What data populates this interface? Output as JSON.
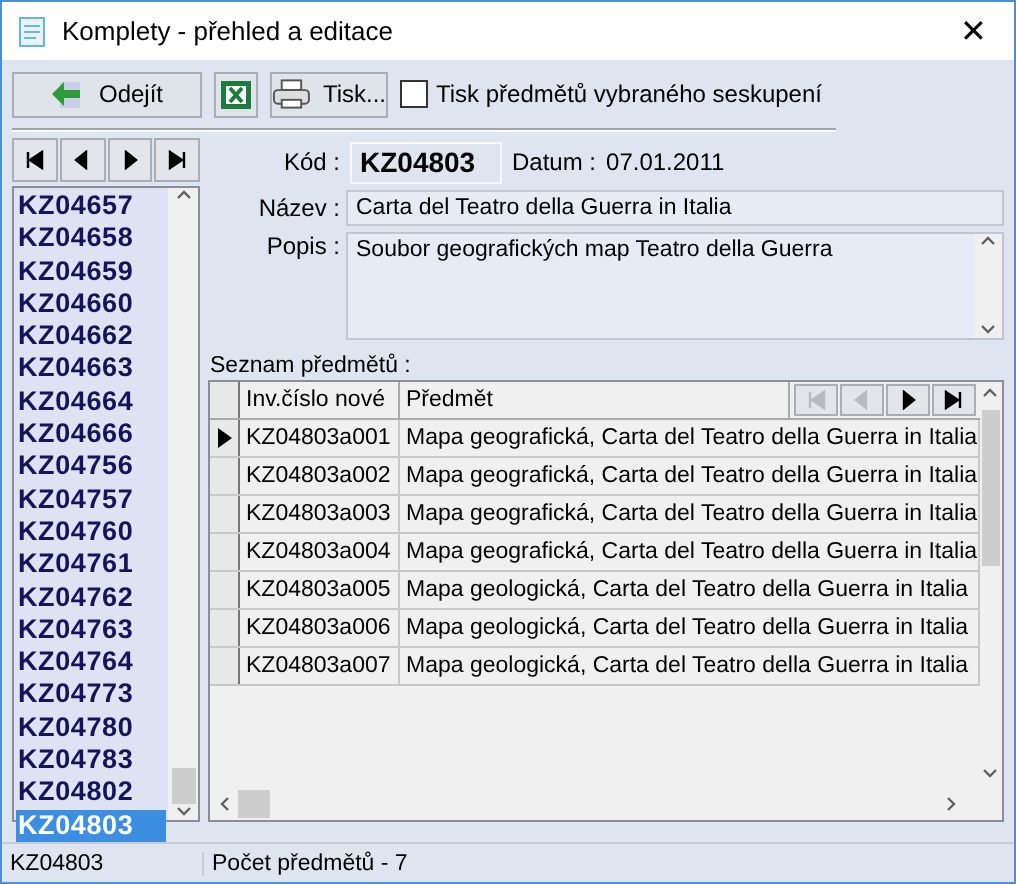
{
  "window": {
    "title": "Komplety - přehled a editace",
    "close": "✕"
  },
  "toolbar": {
    "exit_button": "Odejít",
    "print_button": "Tisk...",
    "print_option": {
      "label": "Tisk předmětů vybraného seskupení",
      "checked": false
    }
  },
  "record_nav": [
    {
      "kind": "first",
      "disabled": false
    },
    {
      "kind": "prev",
      "disabled": false
    },
    {
      "kind": "next",
      "disabled": false
    },
    {
      "kind": "last",
      "disabled": false
    }
  ],
  "list": [
    {
      "label": "KZ04657",
      "selected": false
    },
    {
      "label": "KZ04658",
      "selected": false
    },
    {
      "label": "KZ04659",
      "selected": false
    },
    {
      "label": "KZ04660",
      "selected": false
    },
    {
      "label": "KZ04662",
      "selected": false
    },
    {
      "label": "KZ04663",
      "selected": false
    },
    {
      "label": "KZ04664",
      "selected": false
    },
    {
      "label": "KZ04666",
      "selected": false
    },
    {
      "label": "KZ04756",
      "selected": false
    },
    {
      "label": "KZ04757",
      "selected": false
    },
    {
      "label": "KZ04760",
      "selected": false
    },
    {
      "label": "KZ04761",
      "selected": false
    },
    {
      "label": "KZ04762",
      "selected": false
    },
    {
      "label": "KZ04763",
      "selected": false
    },
    {
      "label": "KZ04764",
      "selected": false
    },
    {
      "label": "KZ04773",
      "selected": false
    },
    {
      "label": "KZ04780",
      "selected": false
    },
    {
      "label": "KZ04783",
      "selected": false
    },
    {
      "label": "KZ04802",
      "selected": false
    },
    {
      "label": "KZ04803",
      "selected": true
    }
  ],
  "detail": {
    "code_label": "Kód :",
    "code": "KZ04803",
    "date_label": "Datum :",
    "date": "07.01.2011",
    "name_label": "Název :",
    "name": "Carta del Teatro della Guerra in Italia",
    "desc_label": "Popis :",
    "desc": "Soubor geografických map Teatro della Guerra"
  },
  "items": {
    "title": "Seznam předmětů :",
    "columns": [
      "Inv.číslo nové",
      "Předmět"
    ],
    "nav": [
      {
        "kind": "first",
        "disabled": true
      },
      {
        "kind": "prev",
        "disabled": true
      },
      {
        "kind": "next",
        "disabled": false
      },
      {
        "kind": "last",
        "disabled": false
      }
    ],
    "rows": [
      {
        "inv": "KZ04803a001",
        "item": "Mapa geografická, Carta del Teatro della Guerra in Italia",
        "selected": true
      },
      {
        "inv": "KZ04803a002",
        "item": "Mapa geografická, Carta del Teatro della Guerra in Italia",
        "selected": false
      },
      {
        "inv": "KZ04803a003",
        "item": "Mapa geografická, Carta del Teatro della Guerra in Italia",
        "selected": false
      },
      {
        "inv": "KZ04803a004",
        "item": "Mapa geografická, Carta del Teatro della Guerra in Italia",
        "selected": false
      },
      {
        "inv": "KZ04803a005",
        "item": "Mapa geologická, Carta del Teatro della Guerra in Italia",
        "selected": false
      },
      {
        "inv": "KZ04803a006",
        "item": "Mapa geologická, Carta del Teatro della Guerra in Italia",
        "selected": false
      },
      {
        "inv": "KZ04803a007",
        "item": "Mapa geologická, Carta del Teatro della Guerra in Italia",
        "selected": false
      }
    ]
  },
  "status_bar": [
    "KZ04803",
    "Počet předmětů - 7"
  ]
}
